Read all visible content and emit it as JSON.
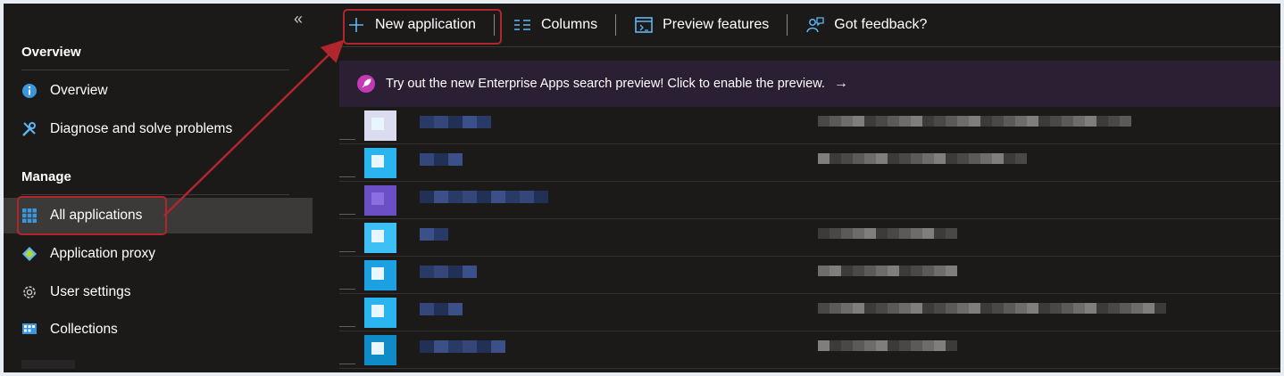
{
  "sidebar": {
    "collapse_glyph": "«",
    "sections": [
      {
        "heading": "Overview"
      },
      {
        "heading": "Manage"
      }
    ],
    "items": [
      {
        "label": "Overview",
        "icon": "info-icon"
      },
      {
        "label": "Diagnose and solve problems",
        "icon": "wrench-icon"
      },
      {
        "label": "All applications",
        "icon": "grid-icon",
        "selected": true
      },
      {
        "label": "Application proxy",
        "icon": "proxy-icon"
      },
      {
        "label": "User settings",
        "icon": "gear-icon"
      },
      {
        "label": "Collections",
        "icon": "collections-icon"
      }
    ]
  },
  "toolbar": {
    "new_application": "New application",
    "columns": "Columns",
    "preview_features": "Preview features",
    "got_feedback": "Got feedback?"
  },
  "banner": {
    "text": "Try out the new Enterprise Apps search preview! Click to enable the preview.",
    "arrow": "→"
  },
  "colors": {
    "background": "#1b1a19",
    "selected": "#3b3a39",
    "banner": "#2a1f33",
    "annotation": "#b0262c",
    "accent": "#0078d4"
  }
}
